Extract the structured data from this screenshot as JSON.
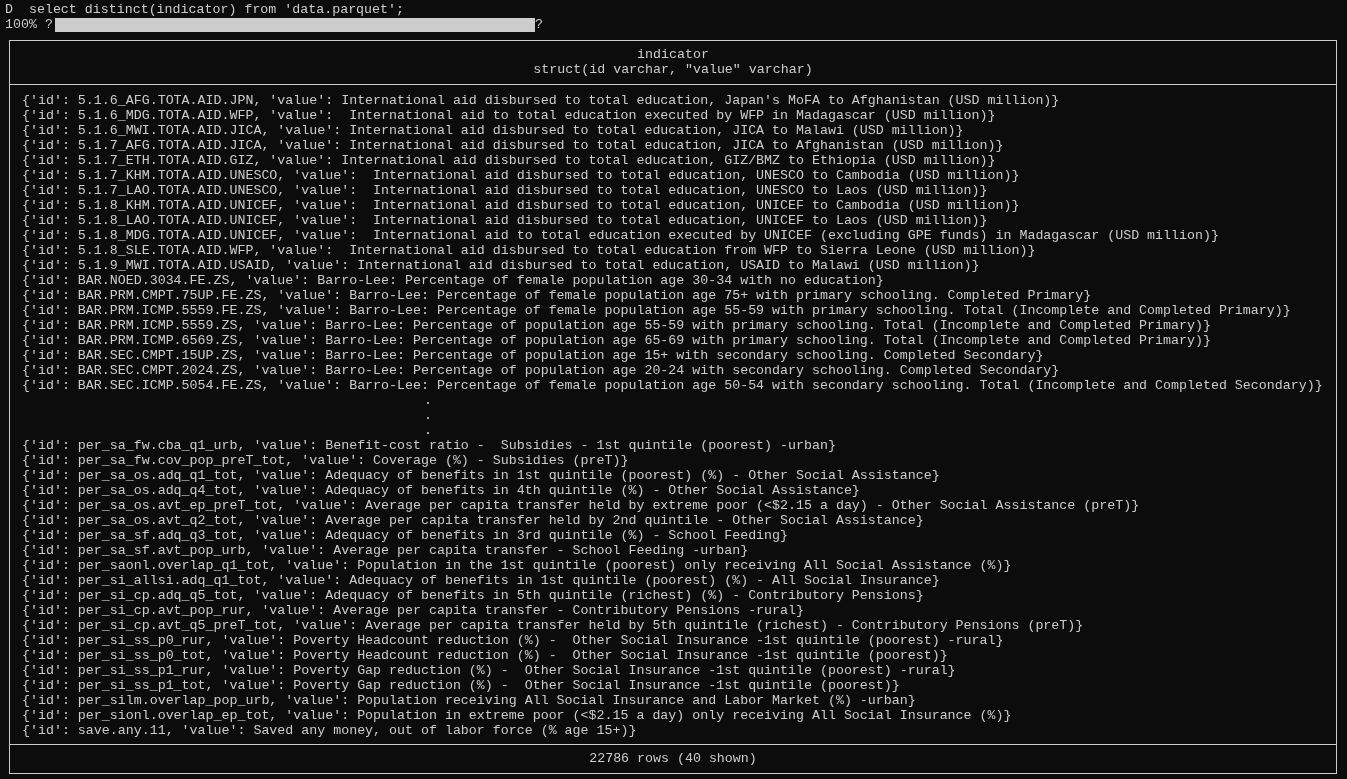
{
  "prompt": "D",
  "command": "select distinct(indicator) from 'data.parquet';",
  "progress": {
    "percent": "100%",
    "left_mark": "?",
    "level": 1,
    "right_mark": "?"
  },
  "table": {
    "column": {
      "name": "indicator",
      "type": "struct(id varchar, \"value\" varchar)"
    },
    "rows": [
      "{'id': 5.1.6_AFG.TOTA.AID.JPN, 'value': International aid disbursed to total education, Japan's MoFA to Afghanistan (USD million)}",
      "{'id': 5.1.6_MDG.TOTA.AID.WFP, 'value':  International aid to total education executed by WFP in Madagascar (USD million)}",
      "{'id': 5.1.6_MWI.TOTA.AID.JICA, 'value': International aid disbursed to total education, JICA to Malawi (USD million)}",
      "{'id': 5.1.7_AFG.TOTA.AID.JICA, 'value': International aid disbursed to total education, JICA to Afghanistan (USD million)}",
      "{'id': 5.1.7_ETH.TOTA.AID.GIZ, 'value': International aid disbursed to total education, GIZ/BMZ to Ethiopia (USD million)}",
      "{'id': 5.1.7_KHM.TOTA.AID.UNESCO, 'value':  International aid disbursed to total education, UNESCO to Cambodia (USD million)}",
      "{'id': 5.1.7_LAO.TOTA.AID.UNESCO, 'value':  International aid disbursed to total education, UNESCO to Laos (USD million)}",
      "{'id': 5.1.8_KHM.TOTA.AID.UNICEF, 'value':  International aid disbursed to total education, UNICEF to Cambodia (USD million)}",
      "{'id': 5.1.8_LAO.TOTA.AID.UNICEF, 'value':  International aid disbursed to total education, UNICEF to Laos (USD million)}",
      "{'id': 5.1.8_MDG.TOTA.AID.UNICEF, 'value':  International aid to total education executed by UNICEF (excluding GPE funds) in Madagascar (USD million)}",
      "{'id': 5.1.8_SLE.TOTA.AID.WFP, 'value':  International aid disbursed to total education from WFP to Sierra Leone (USD million)}",
      "{'id': 5.1.9_MWI.TOTA.AID.USAID, 'value': International aid disbursed to total education, USAID to Malawi (USD million)}",
      "{'id': BAR.NOED.3034.FE.ZS, 'value': Barro-Lee: Percentage of female population age 30-34 with no education}",
      "{'id': BAR.PRM.CMPT.75UP.FE.ZS, 'value': Barro-Lee: Percentage of female population age 75+ with primary schooling. Completed Primary}",
      "{'id': BAR.PRM.ICMP.5559.FE.ZS, 'value': Barro-Lee: Percentage of female population age 55-59 with primary schooling. Total (Incomplete and Completed Primary)}",
      "{'id': BAR.PRM.ICMP.5559.ZS, 'value': Barro-Lee: Percentage of population age 55-59 with primary schooling. Total (Incomplete and Completed Primary)}",
      "{'id': BAR.PRM.ICMP.6569.ZS, 'value': Barro-Lee: Percentage of population age 65-69 with primary schooling. Total (Incomplete and Completed Primary)}",
      "{'id': BAR.SEC.CMPT.15UP.ZS, 'value': Barro-Lee: Percentage of population age 15+ with secondary schooling. Completed Secondary}",
      "{'id': BAR.SEC.CMPT.2024.ZS, 'value': Barro-Lee: Percentage of population age 20-24 with secondary schooling. Completed Secondary}",
      "{'id': BAR.SEC.ICMP.5054.FE.ZS, 'value': Barro-Lee: Percentage of female population age 50-54 with secondary schooling. Total (Incomplete and Completed Secondary)}"
    ],
    "ellipsis": [
      ".",
      ".",
      "."
    ],
    "rows_after": [
      "{'id': per_sa_fw.cba_q1_urb, 'value': Benefit-cost ratio -  Subsidies - 1st quintile (poorest) -urban}",
      "{'id': per_sa_fw.cov_pop_preT_tot, 'value': Coverage (%) - Subsidies (preT)}",
      "{'id': per_sa_os.adq_q1_tot, 'value': Adequacy of benefits in 1st quintile (poorest) (%) - Other Social Assistance}",
      "{'id': per_sa_os.adq_q4_tot, 'value': Adequacy of benefits in 4th quintile (%) - Other Social Assistance}",
      "{'id': per_sa_os.avt_ep_preT_tot, 'value': Average per capita transfer held by extreme poor (<$2.15 a day) - Other Social Assistance (preT)}",
      "{'id': per_sa_os.avt_q2_tot, 'value': Average per capita transfer held by 2nd quintile - Other Social Assistance}",
      "{'id': per_sa_sf.adq_q3_tot, 'value': Adequacy of benefits in 3rd quintile (%) - School Feeding}",
      "{'id': per_sa_sf.avt_pop_urb, 'value': Average per capita transfer - School Feeding -urban}",
      "{'id': per_saonl.overlap_q1_tot, 'value': Population in the 1st quintile (poorest) only receiving All Social Assistance (%)}",
      "{'id': per_si_allsi.adq_q1_tot, 'value': Adequacy of benefits in 1st quintile (poorest) (%) - All Social Insurance}",
      "{'id': per_si_cp.adq_q5_tot, 'value': Adequacy of benefits in 5th quintile (richest) (%) - Contributory Pensions}",
      "{'id': per_si_cp.avt_pop_rur, 'value': Average per capita transfer - Contributory Pensions -rural}",
      "{'id': per_si_cp.avt_q5_preT_tot, 'value': Average per capita transfer held by 5th quintile (richest) - Contributory Pensions (preT)}",
      "{'id': per_si_ss_p0_rur, 'value': Poverty Headcount reduction (%) -  Other Social Insurance -1st quintile (poorest) -rural}",
      "{'id': per_si_ss_p0_tot, 'value': Poverty Headcount reduction (%) -  Other Social Insurance -1st quintile (poorest)}",
      "{'id': per_si_ss_p1_rur, 'value': Poverty Gap reduction (%) -  Other Social Insurance -1st quintile (poorest) -rural}",
      "{'id': per_si_ss_p1_tot, 'value': Poverty Gap reduction (%) -  Other Social Insurance -1st quintile (poorest)}",
      "{'id': per_silm.overlap_pop_urb, 'value': Population receiving All Social Insurance and Labor Market (%) -urban}",
      "{'id': per_sionl.overlap_ep_tot, 'value': Population in extreme poor (<$2.15 a day) only receiving All Social Insurance (%)}",
      "{'id': save.any.11, 'value': Saved any money, out of labor force (% age 15+)}"
    ],
    "footer": "22786 rows (40 shown)"
  }
}
